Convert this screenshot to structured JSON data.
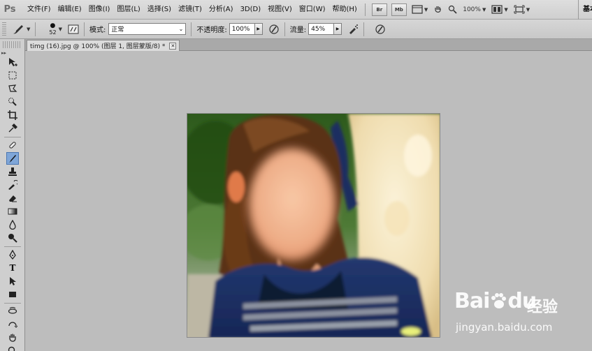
{
  "app": {
    "logo": "Ps"
  },
  "menu": {
    "items": [
      "文件(F)",
      "编辑(E)",
      "图像(I)",
      "图层(L)",
      "选择(S)",
      "滤镜(T)",
      "分析(A)",
      "3D(D)",
      "视图(V)",
      "窗口(W)",
      "帮助(H)"
    ],
    "buttons": [
      "Br",
      "Mb"
    ],
    "zoom": "100%",
    "workspace": "基本"
  },
  "options": {
    "brush_size": "52",
    "mode_label": "模式:",
    "mode_value": "正常",
    "opacity_label": "不透明度:",
    "opacity_value": "100%",
    "flow_label": "流量:",
    "flow_value": "45%"
  },
  "document": {
    "tab_title": "timg (16).jpg @ 100% (图层 1, 图层蒙版/8) *",
    "close_glyph": "✕"
  },
  "watermark": {
    "logo": "Bai",
    "logo2": "du",
    "cn": "经验",
    "url": "jingyan.baidu.com"
  },
  "colors": {
    "accent": "#7fa6d8",
    "panel": "#cfcfcf",
    "workspace": "#bdbdbd"
  }
}
